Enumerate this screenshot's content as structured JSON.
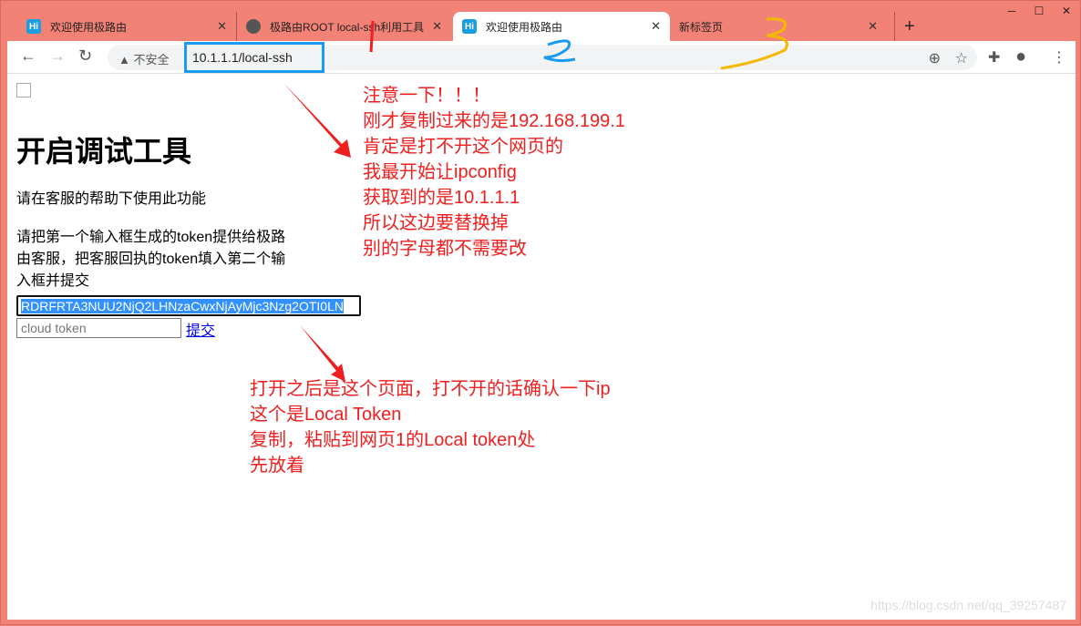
{
  "tabs": [
    {
      "title": "欢迎使用极路由",
      "icon": "hi-icon"
    },
    {
      "title": "极路由ROOT local-ssh利用工具",
      "icon": "globe-icon"
    },
    {
      "title": "欢迎使用极路由",
      "icon": "hi-icon",
      "active": true
    },
    {
      "title": "新标签页"
    }
  ],
  "address": {
    "security": "不安全",
    "url": "10.1.1.1/local-ssh"
  },
  "page": {
    "title": "开启调试工具",
    "line1": "请在客服的帮助下使用此功能",
    "line2a": "请把第一个输入框生成的token提供给极路",
    "line2b": "由客服，把客服回执的token填入第二个输",
    "line2c": "入框并提交",
    "local_token": "RDRFRTA3NUU2NjQ2LHNzaCwxNjAyMjc3Nzg2OTI0LN",
    "cloud_placeholder": "cloud token",
    "submit": "提交"
  },
  "annotations": {
    "note1": [
      "注意一下！！！",
      "刚才复制过来的是192.168.199.1",
      "肯定是打不开这个网页的",
      "我最开始让ipconfig",
      "获取到的是10.1.1.1",
      "所以这边要替换掉",
      "别的字母都不需要改"
    ],
    "note2": [
      "打开之后是这个页面，打不开的话确认一下ip",
      "这个是Local Token",
      "复制，粘贴到网页1的Local token处",
      "先放着"
    ],
    "marks": [
      "1",
      "2",
      "3"
    ]
  },
  "watermark": "https://blog.csdn.net/qq_39257487",
  "colors": {
    "frame": "#f28275",
    "annotation": "#f01e1e",
    "highlight": "#1a9af0"
  }
}
